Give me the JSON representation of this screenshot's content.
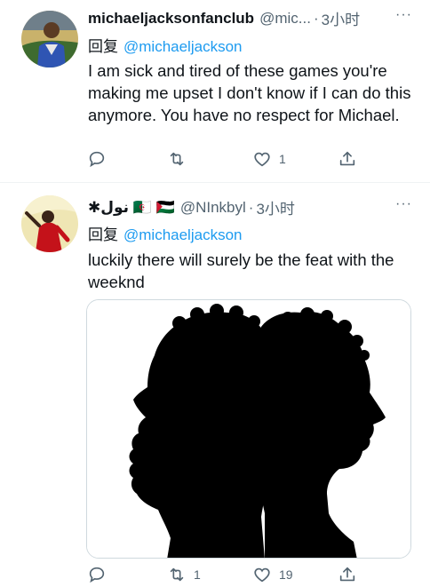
{
  "tweets": [
    {
      "display_name": "michaeljacksonfanclub",
      "handle": "@mic...",
      "separator": "·",
      "time": "3小时",
      "more": "···",
      "reply_prefix": "回复",
      "reply_to": "@michaeljackson",
      "text": "I am sick and tired of these games you're making me upset I don't know if I can do this anymore. You have no respect for Michael.",
      "actions": {
        "reply_count": "",
        "retweet_count": "",
        "like_count": "1"
      }
    },
    {
      "display_name": "✱نول 🇩🇿 🇵🇸",
      "handle": "@NInkbyl",
      "separator": "·",
      "time": "3小时",
      "more": "···",
      "reply_prefix": "回复",
      "reply_to": "@michaeljackson",
      "text": "luckily there will surely be the feat with the weeknd",
      "actions": {
        "reply_count": "",
        "retweet_count": "1",
        "like_count": "19"
      }
    }
  ],
  "colors": {
    "text": "#0f1419",
    "secondary": "#536471",
    "link": "#1d9bf0",
    "border": "#cfd9de"
  },
  "icons": [
    "reply-icon",
    "retweet-icon",
    "like-icon",
    "share-icon",
    "more-icon"
  ]
}
